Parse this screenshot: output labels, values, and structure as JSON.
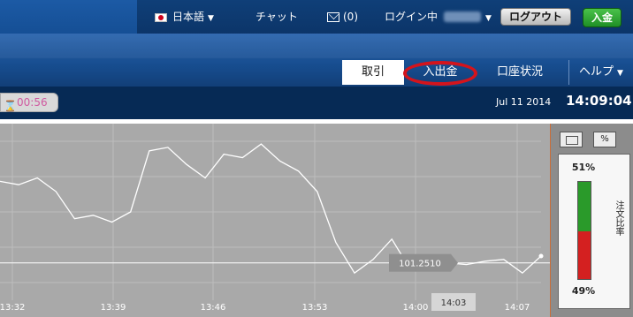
{
  "header": {
    "language": "日本語",
    "chat": "チャット",
    "messages_count": "(0)",
    "login_status": "ログイン中",
    "logout_label": "ログアウト",
    "deposit_label": "入金"
  },
  "nav": {
    "tabs": [
      {
        "label": "取引",
        "active": true
      },
      {
        "label": "入出金",
        "highlighted": true
      },
      {
        "label": "口座状況"
      },
      {
        "label": "ヘルプ"
      }
    ],
    "highlight_color": "#d4141c"
  },
  "status": {
    "timer": "00:56",
    "date": "Jul 11 2014",
    "time": "14:09:04"
  },
  "side_panel": {
    "up_percent": "51%",
    "down_percent": "49%",
    "up_fraction": 0.51,
    "percent_toggle": "%",
    "vertical_label": "注文比率",
    "up_color": "#2a9a2a",
    "down_color": "#d42020"
  },
  "chart_data": {
    "type": "line",
    "current_price_label": "101.2510",
    "cursor_time_label": "14:03",
    "x_ticks": [
      "13:32",
      "13:39",
      "13:46",
      "13:53",
      "14:00",
      "14:07"
    ],
    "series": [
      {
        "values": [
          101.275,
          101.274,
          101.276,
          101.272,
          101.264,
          101.265,
          101.263,
          101.266,
          101.284,
          101.285,
          101.28,
          101.276,
          101.283,
          101.282,
          101.286,
          101.281,
          101.278,
          101.272,
          101.257,
          101.248,
          101.252,
          101.258,
          101.249,
          101.25,
          101.251,
          101.2505,
          101.2515,
          101.252,
          101.248,
          101.253
        ]
      }
    ],
    "reference_line": 101.251,
    "ylim": [
      101.24,
      101.292
    ],
    "grid": true
  }
}
